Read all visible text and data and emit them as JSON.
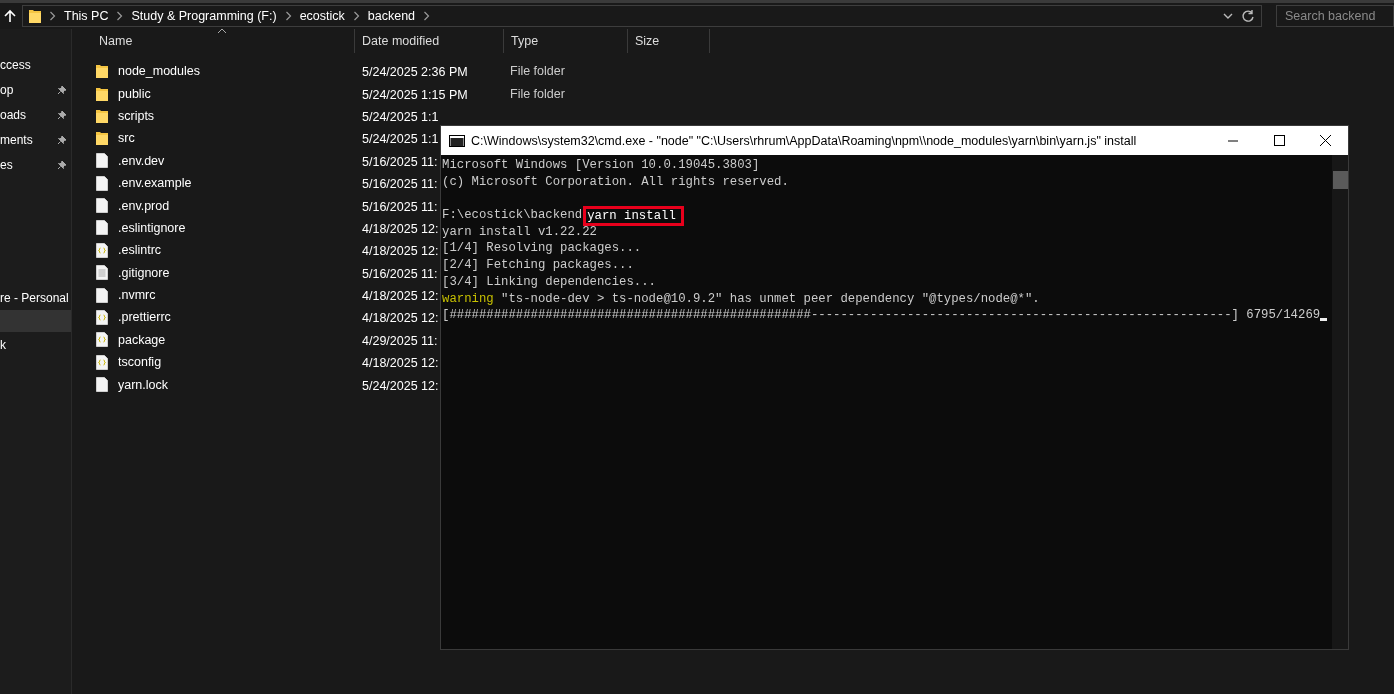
{
  "explorer": {
    "breadcrumbs": [
      "This PC",
      "Study & Programming (F:)",
      "ecostick",
      "backend"
    ],
    "search": {
      "placeholder": "Search backend"
    },
    "sidebar": {
      "groups": [
        [
          {
            "label": "ccess",
            "pinned": false,
            "selected": false
          },
          {
            "label": "op",
            "pinned": true,
            "selected": false
          },
          {
            "label": "oads",
            "pinned": true,
            "selected": false
          },
          {
            "label": "ments",
            "pinned": true,
            "selected": false
          },
          {
            "label": "es",
            "pinned": true,
            "selected": false
          }
        ],
        [
          {
            "label": "re - Personal",
            "selected": false
          },
          {
            "selected": true
          },
          {
            "label": "k",
            "selected": false
          }
        ]
      ]
    },
    "columns": [
      "Name",
      "Date modified",
      "Type",
      "Size"
    ],
    "files": [
      {
        "name": "node_modules",
        "kind": "folder",
        "date": "5/24/2025 2:36 PM",
        "type": "File folder"
      },
      {
        "name": "public",
        "kind": "folder",
        "date": "5/24/2025 1:15 PM",
        "type": "File folder"
      },
      {
        "name": "scripts",
        "kind": "folder",
        "date": "5/24/2025 1:1"
      },
      {
        "name": "src",
        "kind": "folder",
        "date": "5/24/2025 1:1"
      },
      {
        "name": ".env.dev",
        "kind": "file",
        "date": "5/16/2025 11:"
      },
      {
        "name": ".env.example",
        "kind": "file",
        "date": "5/16/2025 11:"
      },
      {
        "name": ".env.prod",
        "kind": "file",
        "date": "5/16/2025 11:"
      },
      {
        "name": ".eslintignore",
        "kind": "file",
        "date": "4/18/2025 12:"
      },
      {
        "name": ".eslintrc",
        "kind": "json",
        "date": "4/18/2025 12:"
      },
      {
        "name": ".gitignore",
        "kind": "text",
        "date": "5/16/2025 11:"
      },
      {
        "name": ".nvmrc",
        "kind": "file",
        "date": "4/18/2025 12:"
      },
      {
        "name": ".prettierrc",
        "kind": "json",
        "date": "4/18/2025 12:"
      },
      {
        "name": "package",
        "kind": "json",
        "date": "4/29/2025 11:"
      },
      {
        "name": "tsconfig",
        "kind": "json",
        "date": "4/18/2025 12:"
      },
      {
        "name": "yarn.lock",
        "kind": "file",
        "date": "5/24/2025 12:"
      }
    ]
  },
  "console": {
    "title": "C:\\Windows\\system32\\cmd.exe  - \"node\"   \"C:\\Users\\rhrum\\AppData\\Roaming\\npm\\\\node_modules\\yarn\\bin\\yarn.js\" install",
    "lines": [
      {
        "kind": "text",
        "text": "Microsoft Windows [Version 10.0.19045.3803]"
      },
      {
        "kind": "text",
        "text": "(c) Microsoft Corporation. All rights reserved."
      },
      {
        "kind": "prompt",
        "text": "F:\\ecostick\\backend",
        "command": "yarn install"
      },
      {
        "kind": "text",
        "text": "yarn install v1.22.22"
      },
      {
        "kind": "text",
        "text": "[1/4] Resolving packages..."
      },
      {
        "kind": "text",
        "text": "[2/4] Fetching packages..."
      },
      {
        "kind": "text",
        "text": "[3/4] Linking dependencies..."
      },
      {
        "kind": "warning",
        "label": "warning",
        "text": " \"ts-node-dev > ts-node@10.9.2\" has unmet peer dependency \"@types/node@*\"."
      },
      {
        "kind": "progress",
        "text": "[#################################################---------------------------------------------------------] 6795/14269"
      }
    ]
  }
}
